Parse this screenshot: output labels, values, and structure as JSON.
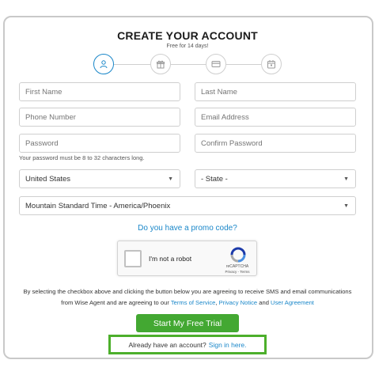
{
  "header": {
    "title": "CREATE YOUR ACCOUNT",
    "subtitle": "Free for 14 days!"
  },
  "steps": [
    {
      "icon": "user-icon",
      "active": true
    },
    {
      "icon": "gift-icon",
      "active": false
    },
    {
      "icon": "credit-card-icon",
      "active": false
    },
    {
      "icon": "calendar-icon",
      "active": false
    }
  ],
  "form": {
    "first_name": {
      "placeholder": "First Name",
      "value": ""
    },
    "last_name": {
      "placeholder": "Last Name",
      "value": ""
    },
    "phone": {
      "placeholder": "Phone Number",
      "value": ""
    },
    "email": {
      "placeholder": "Email Address",
      "value": ""
    },
    "password": {
      "placeholder": "Password",
      "value": ""
    },
    "confirm_password": {
      "placeholder": "Confirm Password",
      "value": ""
    },
    "password_hint": "Your password must be 8 to 32 characters long.",
    "country": {
      "selected": "United States"
    },
    "state": {
      "selected": "- State -"
    },
    "timezone": {
      "selected": "Mountain Standard Time - America/Phoenix"
    },
    "promo_link": "Do you have a promo code?"
  },
  "captcha": {
    "label": "I'm not a robot",
    "brand": "reCAPTCHA",
    "privacy": "Privacy",
    "separator": " - ",
    "terms": "Terms"
  },
  "consent": {
    "text_before": "By selecting the checkbox above and clicking the button below you are agreeing to receive SMS and email communications from Wise Agent and are agreeing to our ",
    "terms_link": "Terms of Service",
    "comma": ", ",
    "privacy_link": "Privacy Notice",
    "and": " and ",
    "user_agreement_link": "User Agreement"
  },
  "cta": {
    "label": "Start My Free Trial"
  },
  "signin": {
    "prompt": "Already have an account?",
    "link": "Sign in here."
  },
  "colors": {
    "accent": "#1a87c9",
    "button_green": "#43a832",
    "highlight_green": "#4caf2b"
  }
}
